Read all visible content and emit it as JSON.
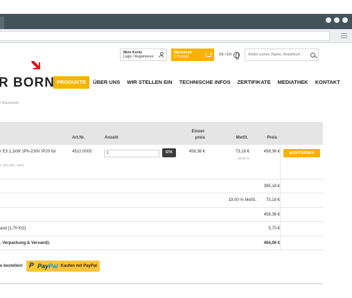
{
  "header": {
    "account_title": "Mein Konto",
    "account_sub": "Login / Registrieren",
    "cart_title": "Warenkorb",
    "cart_sub": "1 Produkt",
    "lang": "DE / EN",
    "search_placeholder": "Artikel suchen (Name, Bestellnum"
  },
  "logo_text": "R BORN",
  "nav": [
    "PRODUKTE",
    "ÜBER UNS",
    "WIR STELLEN EIN",
    "TECHNISCHE INFOS",
    "ZERTIFIKATE",
    "MEDIATHEK",
    "KONTAKT"
  ],
  "breadcrumb": "/ Warenkorb",
  "table": {
    "headers": {
      "artnr": "Art.Nr.",
      "anzahl": "Anzahl",
      "einzel_1": "Einzel-",
      "einzel_2": "preis",
      "mwst": "MwSt.",
      "preis": "Preis"
    },
    "item": {
      "name": "r E3 1,1kW 1Ph-230V IP20 für",
      "sub": "t: 1Ph-200...240V",
      "artnr": "4512.0003",
      "qty": "1",
      "unit_label": "STK",
      "unit_price": "458,36 €",
      "mwst": "73,18 €",
      "mwst_rate": "19,00 %",
      "price": "458,36 €",
      "remove": "ENTFERNEN"
    },
    "totals": [
      {
        "label": "",
        "mid": "",
        "value": "385,18 €"
      },
      {
        "label": "",
        "mid": "19,00 % MwSt.",
        "value": "73,18 €"
      },
      {
        "label": "",
        "mid": "",
        "value": "458,36 €"
      },
      {
        "label": "and [1,70 KG]",
        "mid": "",
        "value": "5,70 €"
      },
      {
        "label": ". Verpackung & Versand):",
        "mid": "",
        "value": "464,06 €"
      }
    ]
  },
  "buttons": {
    "order": "e bestellen!",
    "paypal_pay": "Pay",
    "paypal_pal": "Pal",
    "paypal_text": "Kaufen mit PayPal"
  },
  "colors": {
    "accent": "#f6b300",
    "chrome": "#44525a",
    "logo_red": "#d4181f"
  }
}
